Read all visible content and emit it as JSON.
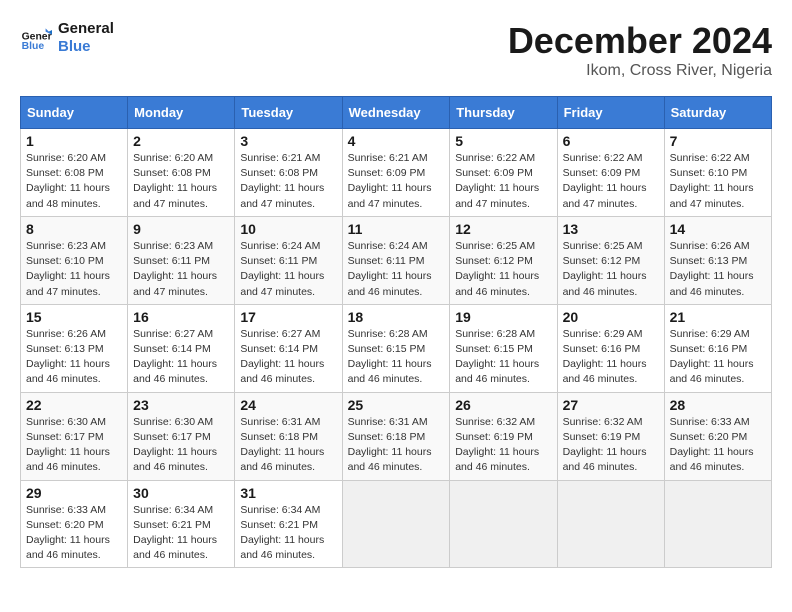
{
  "logo": {
    "line1": "General",
    "line2": "Blue"
  },
  "title": "December 2024",
  "subtitle": "Ikom, Cross River, Nigeria",
  "days_of_week": [
    "Sunday",
    "Monday",
    "Tuesday",
    "Wednesday",
    "Thursday",
    "Friday",
    "Saturday"
  ],
  "weeks": [
    [
      {
        "day": "1",
        "info": "Sunrise: 6:20 AM\nSunset: 6:08 PM\nDaylight: 11 hours\nand 48 minutes."
      },
      {
        "day": "2",
        "info": "Sunrise: 6:20 AM\nSunset: 6:08 PM\nDaylight: 11 hours\nand 47 minutes."
      },
      {
        "day": "3",
        "info": "Sunrise: 6:21 AM\nSunset: 6:08 PM\nDaylight: 11 hours\nand 47 minutes."
      },
      {
        "day": "4",
        "info": "Sunrise: 6:21 AM\nSunset: 6:09 PM\nDaylight: 11 hours\nand 47 minutes."
      },
      {
        "day": "5",
        "info": "Sunrise: 6:22 AM\nSunset: 6:09 PM\nDaylight: 11 hours\nand 47 minutes."
      },
      {
        "day": "6",
        "info": "Sunrise: 6:22 AM\nSunset: 6:09 PM\nDaylight: 11 hours\nand 47 minutes."
      },
      {
        "day": "7",
        "info": "Sunrise: 6:22 AM\nSunset: 6:10 PM\nDaylight: 11 hours\nand 47 minutes."
      }
    ],
    [
      {
        "day": "8",
        "info": "Sunrise: 6:23 AM\nSunset: 6:10 PM\nDaylight: 11 hours\nand 47 minutes."
      },
      {
        "day": "9",
        "info": "Sunrise: 6:23 AM\nSunset: 6:11 PM\nDaylight: 11 hours\nand 47 minutes."
      },
      {
        "day": "10",
        "info": "Sunrise: 6:24 AM\nSunset: 6:11 PM\nDaylight: 11 hours\nand 47 minutes."
      },
      {
        "day": "11",
        "info": "Sunrise: 6:24 AM\nSunset: 6:11 PM\nDaylight: 11 hours\nand 46 minutes."
      },
      {
        "day": "12",
        "info": "Sunrise: 6:25 AM\nSunset: 6:12 PM\nDaylight: 11 hours\nand 46 minutes."
      },
      {
        "day": "13",
        "info": "Sunrise: 6:25 AM\nSunset: 6:12 PM\nDaylight: 11 hours\nand 46 minutes."
      },
      {
        "day": "14",
        "info": "Sunrise: 6:26 AM\nSunset: 6:13 PM\nDaylight: 11 hours\nand 46 minutes."
      }
    ],
    [
      {
        "day": "15",
        "info": "Sunrise: 6:26 AM\nSunset: 6:13 PM\nDaylight: 11 hours\nand 46 minutes."
      },
      {
        "day": "16",
        "info": "Sunrise: 6:27 AM\nSunset: 6:14 PM\nDaylight: 11 hours\nand 46 minutes."
      },
      {
        "day": "17",
        "info": "Sunrise: 6:27 AM\nSunset: 6:14 PM\nDaylight: 11 hours\nand 46 minutes."
      },
      {
        "day": "18",
        "info": "Sunrise: 6:28 AM\nSunset: 6:15 PM\nDaylight: 11 hours\nand 46 minutes."
      },
      {
        "day": "19",
        "info": "Sunrise: 6:28 AM\nSunset: 6:15 PM\nDaylight: 11 hours\nand 46 minutes."
      },
      {
        "day": "20",
        "info": "Sunrise: 6:29 AM\nSunset: 6:16 PM\nDaylight: 11 hours\nand 46 minutes."
      },
      {
        "day": "21",
        "info": "Sunrise: 6:29 AM\nSunset: 6:16 PM\nDaylight: 11 hours\nand 46 minutes."
      }
    ],
    [
      {
        "day": "22",
        "info": "Sunrise: 6:30 AM\nSunset: 6:17 PM\nDaylight: 11 hours\nand 46 minutes."
      },
      {
        "day": "23",
        "info": "Sunrise: 6:30 AM\nSunset: 6:17 PM\nDaylight: 11 hours\nand 46 minutes."
      },
      {
        "day": "24",
        "info": "Sunrise: 6:31 AM\nSunset: 6:18 PM\nDaylight: 11 hours\nand 46 minutes."
      },
      {
        "day": "25",
        "info": "Sunrise: 6:31 AM\nSunset: 6:18 PM\nDaylight: 11 hours\nand 46 minutes."
      },
      {
        "day": "26",
        "info": "Sunrise: 6:32 AM\nSunset: 6:19 PM\nDaylight: 11 hours\nand 46 minutes."
      },
      {
        "day": "27",
        "info": "Sunrise: 6:32 AM\nSunset: 6:19 PM\nDaylight: 11 hours\nand 46 minutes."
      },
      {
        "day": "28",
        "info": "Sunrise: 6:33 AM\nSunset: 6:20 PM\nDaylight: 11 hours\nand 46 minutes."
      }
    ],
    [
      {
        "day": "29",
        "info": "Sunrise: 6:33 AM\nSunset: 6:20 PM\nDaylight: 11 hours\nand 46 minutes."
      },
      {
        "day": "30",
        "info": "Sunrise: 6:34 AM\nSunset: 6:21 PM\nDaylight: 11 hours\nand 46 minutes."
      },
      {
        "day": "31",
        "info": "Sunrise: 6:34 AM\nSunset: 6:21 PM\nDaylight: 11 hours\nand 46 minutes."
      },
      null,
      null,
      null,
      null
    ]
  ]
}
